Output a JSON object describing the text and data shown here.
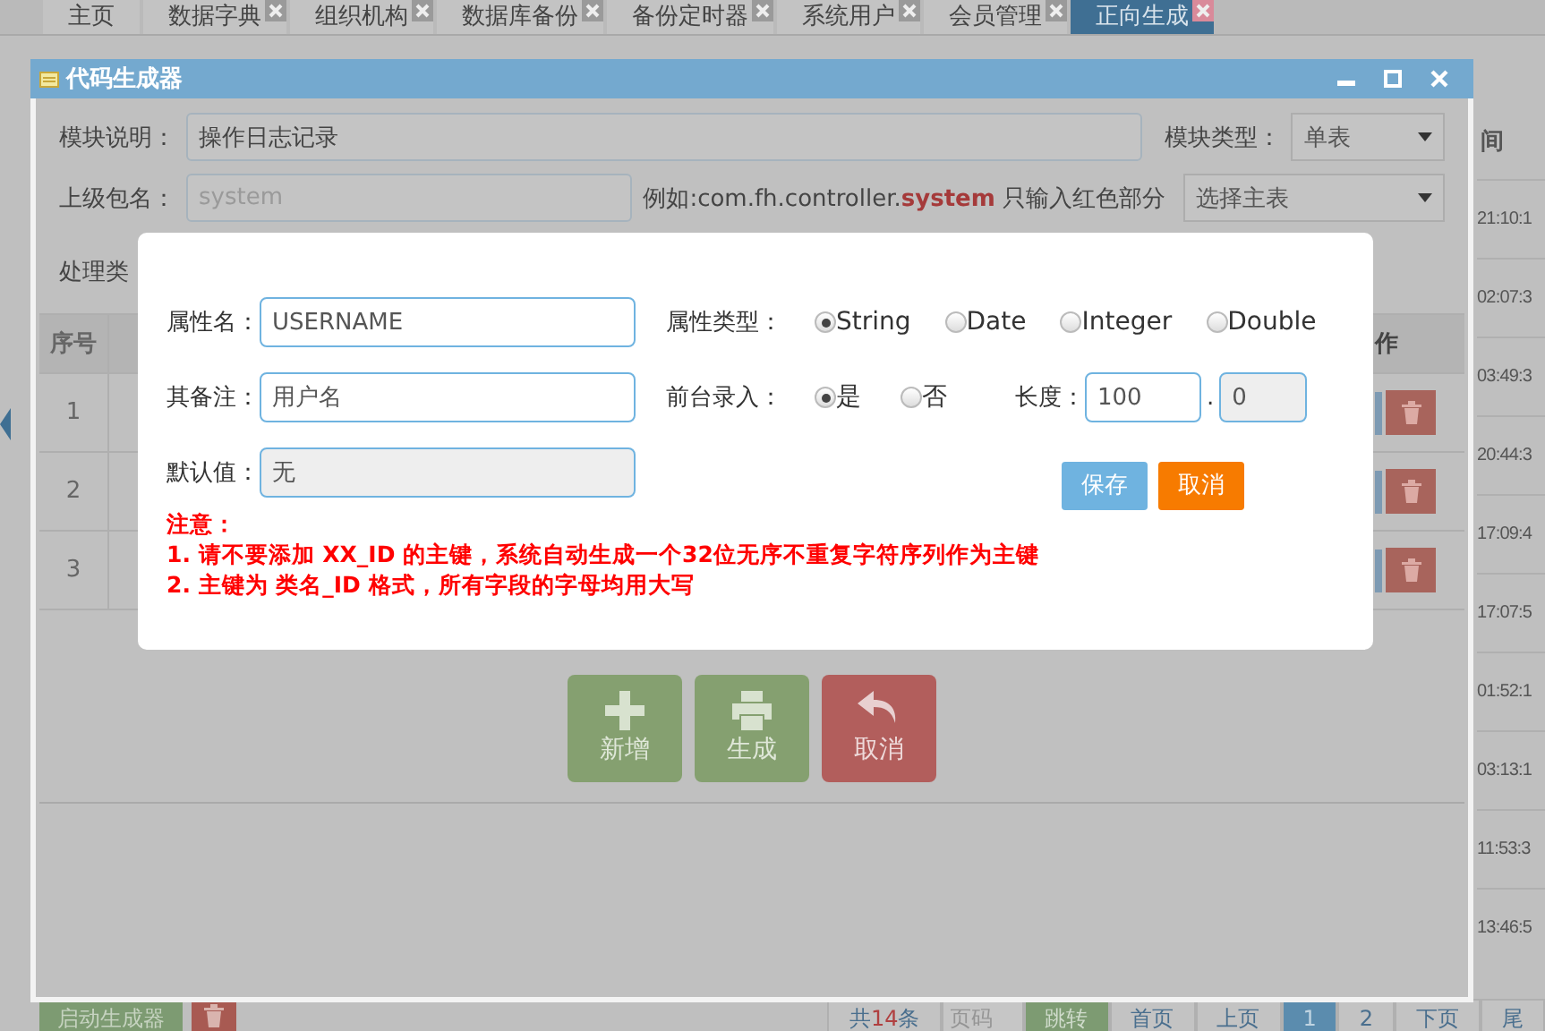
{
  "tabs": [
    {
      "label": "主页",
      "selected": false,
      "closable": false
    },
    {
      "label": "数据字典",
      "selected": false,
      "closable": true
    },
    {
      "label": "组织机构",
      "selected": false,
      "closable": true
    },
    {
      "label": "数据库备份",
      "selected": false,
      "closable": true
    },
    {
      "label": "备份定时器",
      "selected": false,
      "closable": true
    },
    {
      "label": "系统用户",
      "selected": false,
      "closable": true
    },
    {
      "label": "会员管理",
      "selected": false,
      "closable": true
    },
    {
      "label": "正向生成",
      "selected": true,
      "closable": true
    }
  ],
  "background": {
    "time_header": "间",
    "times": [
      "21:10:1",
      "02:07:3",
      "03:49:3",
      "20:44:3",
      "17:09:4",
      "17:07:5",
      "01:52:1",
      "03:13:1",
      "11:53:3",
      "13:46:5"
    ],
    "start_button": "启动生成器",
    "total_prefix": "共",
    "total_count": "14",
    "total_suffix": "条",
    "page_placeholder": "页码",
    "jump_button": "跳转",
    "first": "首页",
    "prev": "上页",
    "pages": [
      {
        "label": "1",
        "selected": true
      },
      {
        "label": "2",
        "selected": false
      }
    ],
    "next": "下页",
    "last": "尾"
  },
  "window": {
    "title": "代码生成器",
    "module_desc": {
      "label": "模块说明：",
      "value": "操作日志记录"
    },
    "module_type": {
      "label": "模块类型：",
      "value": "单表"
    },
    "parent_package": {
      "label": "上级包名：",
      "placeholder": "system"
    },
    "package_hint": {
      "prefix": "例如:com.fh.controller.",
      "red": "system",
      "suffix": " 只输入红色部分"
    },
    "main_table": {
      "placeholder": "选择主表"
    },
    "class_label": "处理类",
    "table": {
      "columns": [
        "序号",
        "作"
      ],
      "rows": [
        {
          "index": "1"
        },
        {
          "index": "2"
        },
        {
          "index": "3"
        }
      ]
    },
    "actions": [
      {
        "label": "新增",
        "kind": "add"
      },
      {
        "label": "生成",
        "kind": "generate"
      },
      {
        "label": "取消",
        "kind": "cancel"
      }
    ]
  },
  "dialog": {
    "name": {
      "label": "属性名：",
      "value": "USERNAME"
    },
    "type_label": "属性类型：",
    "types": [
      {
        "label": "String",
        "selected": true
      },
      {
        "label": "Date",
        "selected": false
      },
      {
        "label": "Integer",
        "selected": false
      },
      {
        "label": "Double",
        "selected": false
      }
    ],
    "remark": {
      "label": "其备注：",
      "value": "用户名"
    },
    "front_label": "前台录入：",
    "front_options": [
      {
        "label": "是",
        "selected": true
      },
      {
        "label": "否",
        "selected": false
      }
    ],
    "length_label": "长度：",
    "length": "100",
    "separator": ".",
    "decimals": "0",
    "default": {
      "label": "默认值：",
      "value": "无"
    },
    "buttons": [
      {
        "label": "保存",
        "kind": "save"
      },
      {
        "label": "取消",
        "kind": "cancel"
      }
    ],
    "notes": [
      "注意：",
      "1. 请不要添加 XX_ID 的主键，系统自动生成一个32位无序不重复字符序列作为主键",
      "2. 主键为 类名_ID 格式，所有字段的字母均用大写"
    ]
  }
}
